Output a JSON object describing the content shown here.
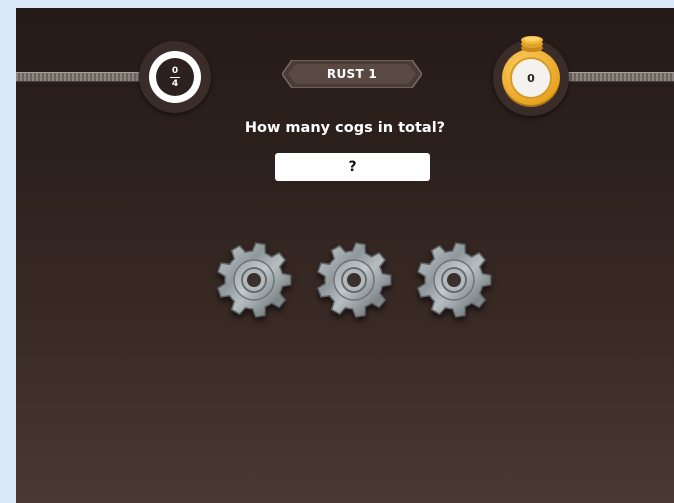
{
  "hud": {
    "progress": {
      "numerator": "0",
      "denominator": "4",
      "value": 0
    },
    "level_label": "RUST 1",
    "coins": "0"
  },
  "question": {
    "text": "How many cogs in total?",
    "answer_placeholder": "?"
  },
  "cogs": [
    {
      "name": "cog-1"
    },
    {
      "name": "cog-2"
    },
    {
      "name": "cog-3"
    }
  ],
  "colors": {
    "background_top": "#241a17",
    "background_bottom": "#4a3833",
    "coin_gold": "#e8a21f",
    "cog_metal": "#9aa3a6"
  }
}
